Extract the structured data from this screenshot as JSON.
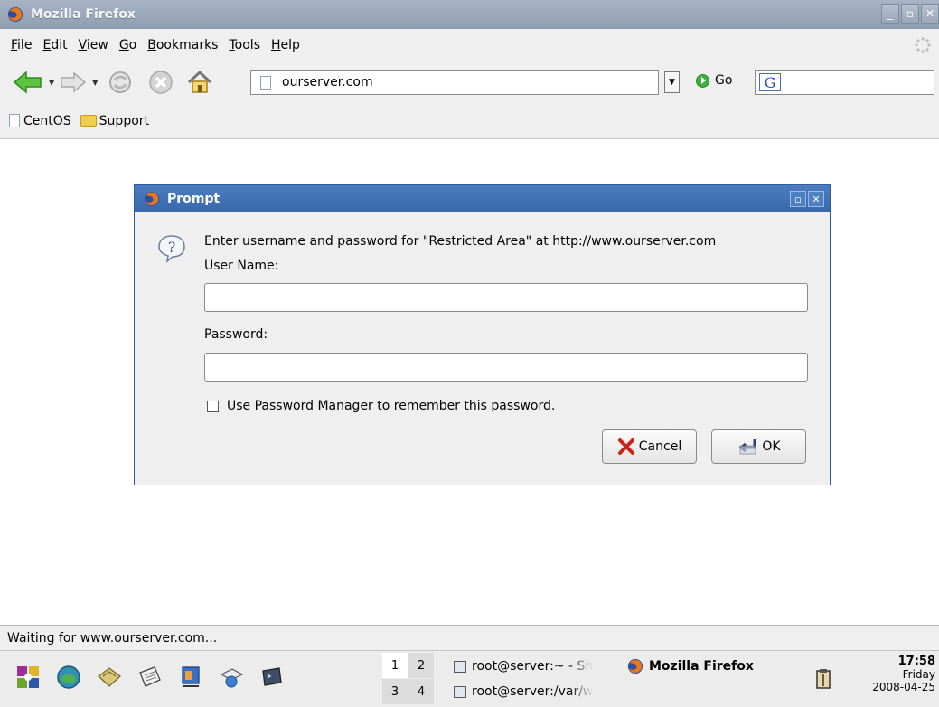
{
  "window": {
    "title": "Mozilla Firefox",
    "controls": [
      "_",
      "▫",
      "✕"
    ]
  },
  "menubar": {
    "items": [
      {
        "label": "File",
        "u": "F",
        "rest": "ile"
      },
      {
        "label": "Edit",
        "u": "E",
        "rest": "dit"
      },
      {
        "label": "View",
        "u": "V",
        "rest": "iew"
      },
      {
        "label": "Go",
        "u": "G",
        "rest": "o"
      },
      {
        "label": "Bookmarks",
        "u": "B",
        "rest": "ookmarks"
      },
      {
        "label": "Tools",
        "u": "T",
        "rest": "ools"
      },
      {
        "label": "Help",
        "u": "H",
        "rest": "elp"
      }
    ]
  },
  "navbar": {
    "url": "ourserver.com",
    "go_label": "Go",
    "search_value": ""
  },
  "bookmarks": {
    "items": [
      "CentOS",
      "Support"
    ]
  },
  "dialog": {
    "title": "Prompt",
    "message": "Enter username and password for \"Restricted Area\" at http://www.ourserver.com",
    "username_label": "User Name:",
    "username_value": "",
    "password_label": "Password:",
    "password_value": "",
    "checkbox_label": "Use Password Manager to remember this password.",
    "checkbox_checked": false,
    "cancel_label": "Cancel",
    "ok_label": "OK"
  },
  "statusbar": {
    "text": "Waiting for www.ourserver.com..."
  },
  "taskbar": {
    "pager": [
      "1",
      "2",
      "3",
      "4"
    ],
    "tasks": [
      {
        "label": "root@server:~ - Sh"
      },
      {
        "label": "Mozilla Firefox"
      },
      {
        "label": "root@server:/var/w"
      }
    ],
    "clock": {
      "time": "17:58",
      "day": "Friday",
      "date": "2008-04-25"
    }
  },
  "colors": {
    "titlebar": "#8f9db0",
    "dialog_title": "#3768ad",
    "chrome_bg": "#efefef"
  }
}
